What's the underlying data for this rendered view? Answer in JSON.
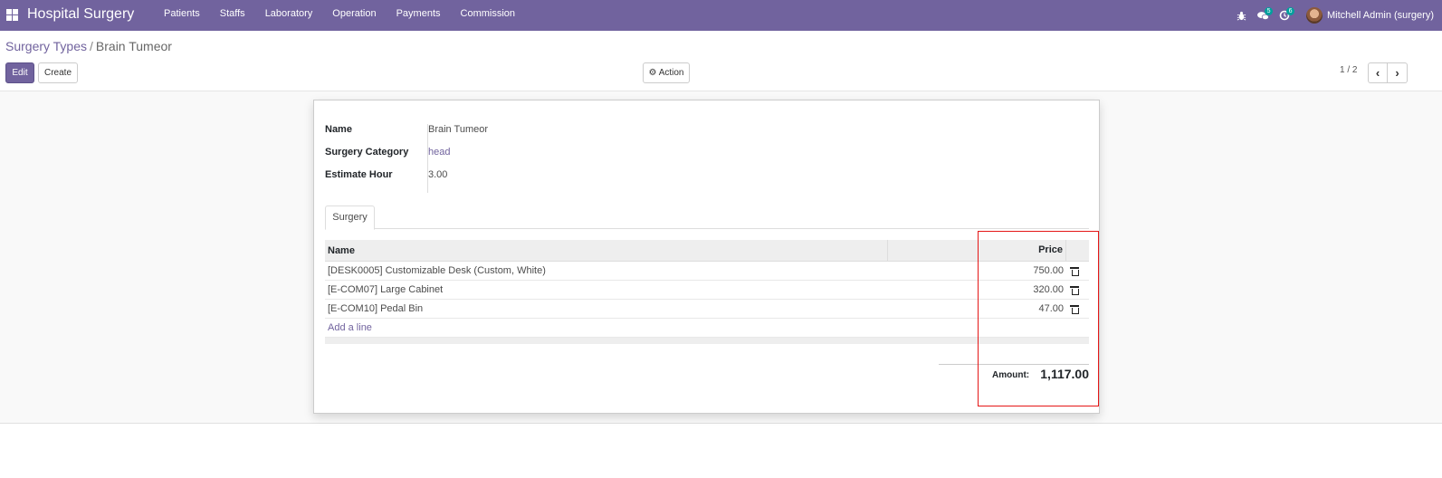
{
  "navbar": {
    "brand": "Hospital Surgery",
    "menu": [
      "Patients",
      "Staffs",
      "Laboratory",
      "Operation",
      "Payments",
      "Commission"
    ],
    "messages_count": "5",
    "activities_count": "6",
    "user_name": "Mitchell Admin (surgery)",
    "bg_color": "#71639e"
  },
  "breadcrumb": {
    "parent": "Surgery Types",
    "separator": "/",
    "current": "Brain Tumeor"
  },
  "buttons": {
    "edit": "Edit",
    "create": "Create",
    "action": "Action"
  },
  "pager": {
    "value": "1 / 2"
  },
  "form": {
    "fields": [
      {
        "label": "Name",
        "value": "Brain Tumeor"
      },
      {
        "label": "Surgery Category",
        "value": "head"
      },
      {
        "label": "Estimate Hour",
        "value": "3.00"
      }
    ],
    "tab": "Surgery",
    "table": {
      "headers": [
        "Name",
        "Price"
      ],
      "rows": [
        {
          "name": "[DESK0005] Customizable Desk (Custom, White)",
          "price": "750.00"
        },
        {
          "name": "[E-COM07] Large Cabinet",
          "price": "320.00"
        },
        {
          "name": "[E-COM10] Pedal Bin",
          "price": "47.00"
        }
      ],
      "add_line": "Add a line"
    },
    "total": {
      "label": "Amount:",
      "value": "1,117.00"
    }
  },
  "annotation_color": "#e51616"
}
